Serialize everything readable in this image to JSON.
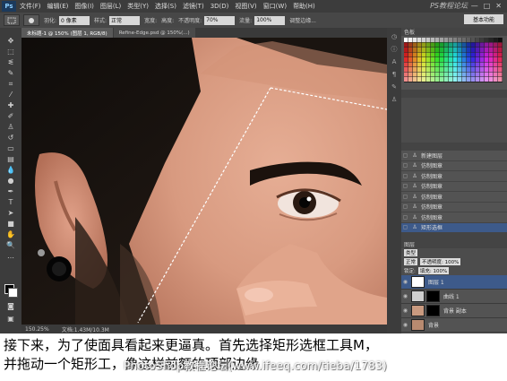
{
  "menubar": {
    "logo": "Ps",
    "items": [
      "文件(F)",
      "编辑(E)",
      "图像(I)",
      "图层(L)",
      "类型(Y)",
      "选择(S)",
      "滤镜(T)",
      "3D(D)",
      "视图(V)",
      "窗口(W)",
      "帮助(H)"
    ],
    "brand": "PS教程论坛",
    "window_controls": [
      "—",
      "□",
      "✕"
    ]
  },
  "options_bar": {
    "feather_label": "羽化:",
    "feather_value": "0 像素",
    "style_label": "样式:",
    "style_value": "正常",
    "width_label": "宽度:",
    "height_label": "高度:",
    "opacity_label": "不透明度:",
    "opacity_value": "70%",
    "flow_label": "流量:",
    "flow_value": "100%",
    "refine_label": "调整边缘...",
    "workspace": "基本功能"
  },
  "document": {
    "tabs": [
      "未标题-1 @ 150% (图层 1, RGB/8)",
      "Refine-Edge.psd @ 150%(...)"
    ],
    "zoom": "150.25%",
    "status": "文档:1.43M/10.3M"
  },
  "swatches": {
    "title": "色板"
  },
  "history": {
    "items": [
      {
        "label": "新建图层",
        "selected": false
      },
      {
        "label": "仿制图章",
        "selected": false
      },
      {
        "label": "仿制图章",
        "selected": false
      },
      {
        "label": "仿制图章",
        "selected": false
      },
      {
        "label": "仿制图章",
        "selected": false
      },
      {
        "label": "仿制图章",
        "selected": false
      },
      {
        "label": "仿制图章",
        "selected": false
      },
      {
        "label": "矩形选框",
        "selected": true
      }
    ]
  },
  "layers": {
    "title": "图层",
    "kind": "类型",
    "blend": "正常",
    "opacity": "不透明度: 100%",
    "lock": "锁定:",
    "fill": "填充: 100%",
    "rows": [
      {
        "name": "图层 1",
        "selected": true,
        "thumb": "#ffffff",
        "mask": false
      },
      {
        "name": "曲线 1",
        "selected": false,
        "thumb": "#cfcfcf",
        "mask": true
      },
      {
        "name": "背景 副本",
        "selected": false,
        "thumb": "#c99a80",
        "mask": true
      },
      {
        "name": "背景",
        "selected": false,
        "thumb": "#b88a70",
        "mask": false
      }
    ]
  },
  "caption": {
    "line1": "接下来，为了使面具看起来更逼真。首先选择矩形选框工具M，",
    "line2": "并拖动一个矩形工，像这样前额的顶部边缘"
  },
  "watermark": "PhotoShop教程论坛(www.ifeeq.com/tieba/1783)"
}
